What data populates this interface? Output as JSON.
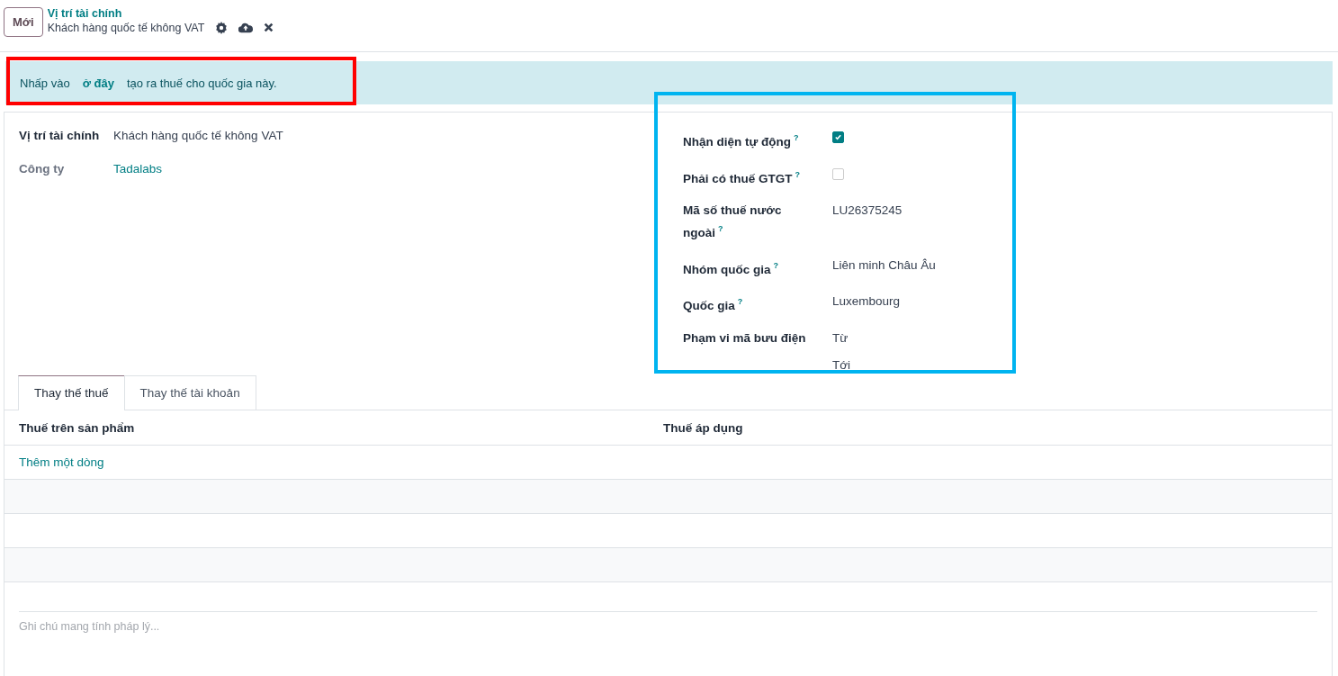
{
  "control_panel": {
    "new_button": "Mới",
    "breadcrumb": "Vị trí tài chính",
    "record_name": "Khách hàng quốc tế không VAT"
  },
  "alert": {
    "before": "Nhấp vào",
    "link": "ở đây",
    "after": "tạo ra thuế cho quốc gia này."
  },
  "left_fields": [
    {
      "label": "Vị trí tài chính",
      "value": "Khách hàng quốc tế không VAT",
      "kind": "text",
      "strong": true
    },
    {
      "label": "Công ty",
      "value": "Tadalabs",
      "kind": "link",
      "strong": false
    }
  ],
  "right_fields": [
    {
      "label": "Nhận diện tự động",
      "help": "?",
      "kind": "checkbox",
      "checked": true
    },
    {
      "label": "Phải có thuế GTGT",
      "help": "?",
      "kind": "checkbox",
      "checked": false
    },
    {
      "label": "Mã số thuế nước ngoài",
      "help": "?",
      "kind": "text",
      "value": "LU26375245"
    },
    {
      "label": "Nhóm quốc gia",
      "help": "?",
      "kind": "text",
      "value": "Liên minh Châu Âu"
    },
    {
      "label": "Quốc gia",
      "help": "?",
      "kind": "text",
      "value": "Luxembourg"
    },
    {
      "label": "Phạm vi mã bưu điện",
      "kind": "range",
      "values": [
        "Từ",
        "Tới"
      ]
    }
  ],
  "tabs": [
    {
      "label": "Thay thế thuế",
      "selected": true
    },
    {
      "label": "Thay thế tài khoản",
      "selected": false
    }
  ],
  "table": {
    "columns": [
      "Thuế trên sản phẩm",
      "Thuế áp dụng"
    ],
    "add_line": "Thêm một dòng"
  },
  "note": {
    "placeholder": "Ghi chú mang tính pháp lý..."
  }
}
